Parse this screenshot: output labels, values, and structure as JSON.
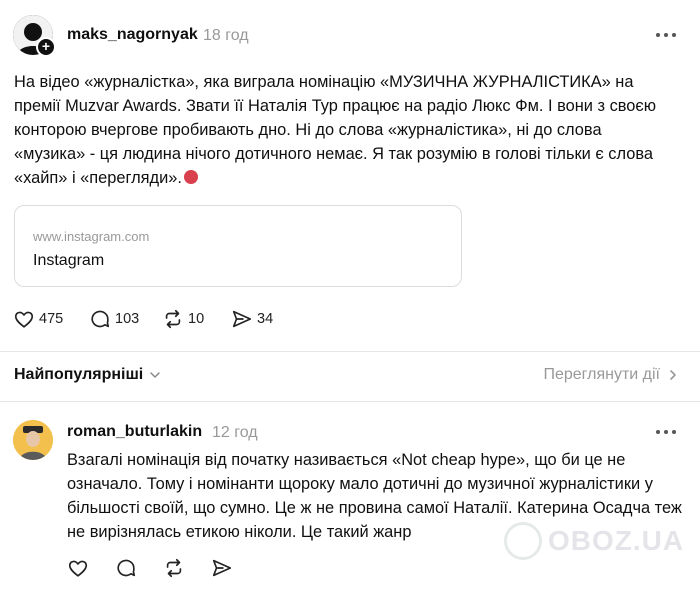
{
  "post": {
    "username": "maks_nagornyak",
    "time": "18 год",
    "text": "На відео «журналістка», яка виграла номінацію «МУЗИЧНА ЖУРНАЛІСТИКА» на премії Muzvar Awards. Звати її Наталія Тур працює на радіо Люкс Фм. І вони з своєю конторою вчергове пробивають дно. Ні до слова «журналістика», ні до слова «музика» - ця людина нічого дотичного немає. Я так розумію в голові тільки є слова «хайп» і «перегляди».",
    "link_card": {
      "domain": "www.instagram.com",
      "title": "Instagram"
    },
    "stats": {
      "likes": "475",
      "comments": "103",
      "reposts": "10",
      "shares": "34"
    }
  },
  "replies_header": {
    "sort_label": "Найпопулярніші",
    "view_activity_label": "Переглянути дії"
  },
  "reply": {
    "username": "roman_buturlakin",
    "time": "12 год",
    "text": "Взагалі номінація від початку називається «Not cheap hype», що би це не означало. Тому і номінанти щороку мало дотичні до музичної журналістики у більшості своїй, що сумно. Це ж не провина самої Наталії. Катерина Осадча теж не вирізнялась етикою ніколи. Це такий жанр"
  },
  "watermark": {
    "text": "OBOZ.UA"
  },
  "icons": {
    "like": "heart-icon",
    "comment": "speech-bubble-icon",
    "repost": "repost-icon",
    "share": "send-icon",
    "more": "more-dots-icon",
    "chevron": "chevron-down-icon",
    "arrow": "chevron-right-icon",
    "follow": "plus-icon"
  },
  "colors": {
    "text": "#101010",
    "muted": "#999999",
    "border": "#dcdcdc",
    "emoji": "#d9414e",
    "avatar2_bg": "#f3c04d"
  }
}
